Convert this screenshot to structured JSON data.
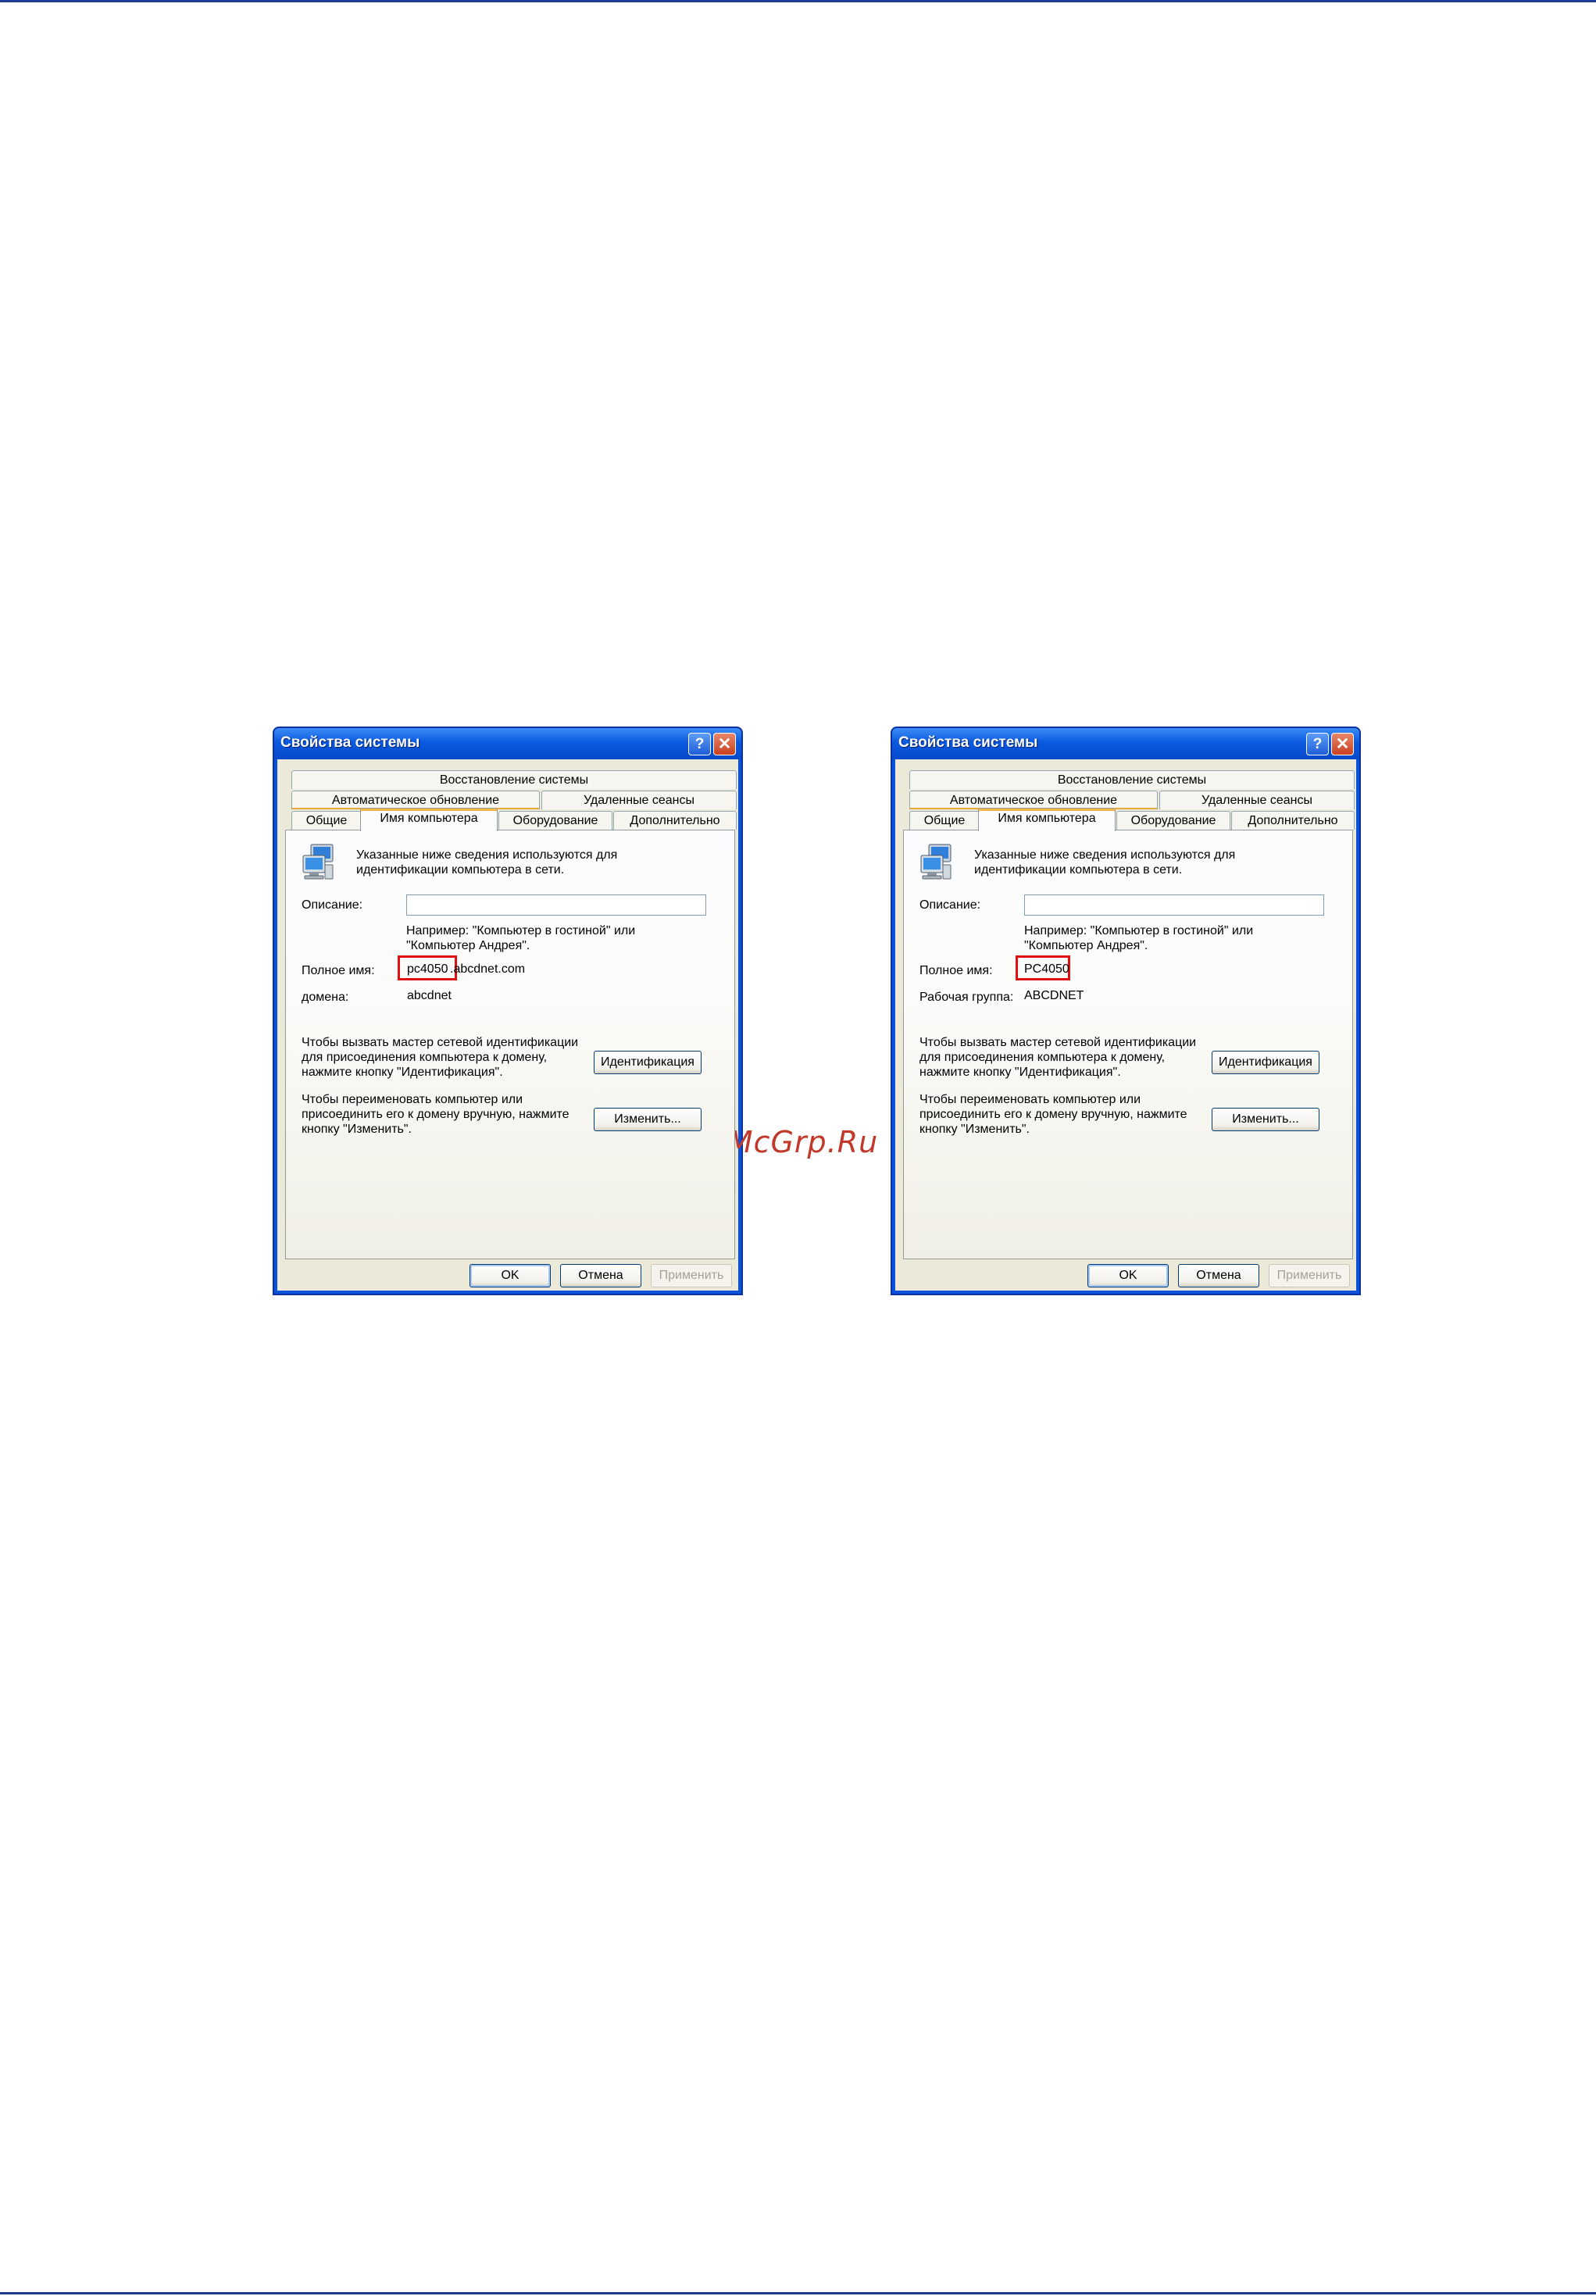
{
  "watermark": "McGrp.Ru",
  "dialogs": [
    {
      "title": "Свойства системы",
      "help_glyph": "?",
      "close_glyph": "✕",
      "tabs": {
        "restore": "Восстановление системы",
        "auto_update": "Автоматическое обновление",
        "remote": "Удаленные сеансы",
        "general": "Общие",
        "computer_name": "Имя компьютера",
        "hardware": "Оборудование",
        "advanced": "Дополнительно"
      },
      "info_line1": "Указанные ниже сведения используются для",
      "info_line2": "идентификации компьютера в сети.",
      "description_label": "Описание:",
      "description_value": "",
      "example_line1": "Например: \"Компьютер в гостиной\" или",
      "example_line2": "\"Компьютер Андрея\".",
      "fullname_label": "Полное имя:",
      "fullname_highlight": "pc4050",
      "fullname_rest": ".abcdnet.com",
      "group_label": "домена:",
      "group_value": "abcdnet",
      "wizard_line1": "Чтобы вызвать мастер сетевой идентификации",
      "wizard_line2": "для присоединения компьютера к домену,",
      "wizard_line3": "нажмите кнопку \"Идентификация\".",
      "ident_button": "Идентификация",
      "rename_line1": "Чтобы переименовать компьютер или",
      "rename_line2": "присоединить его к домену вручную, нажмите",
      "rename_line3": "кнопку \"Изменить\".",
      "change_button": "Изменить...",
      "ok_button": "OK",
      "cancel_button": "Отмена",
      "apply_button": "Применить"
    },
    {
      "title": "Свойства системы",
      "help_glyph": "?",
      "close_glyph": "✕",
      "tabs": {
        "restore": "Восстановление системы",
        "auto_update": "Автоматическое обновление",
        "remote": "Удаленные сеансы",
        "general": "Общие",
        "computer_name": "Имя компьютера",
        "hardware": "Оборудование",
        "advanced": "Дополнительно"
      },
      "info_line1": "Указанные ниже сведения используются для",
      "info_line2": "идентификации компьютера в сети.",
      "description_label": "Описание:",
      "description_value": "",
      "example_line1": "Например: \"Компьютер в гостиной\" или",
      "example_line2": "\"Компьютер Андрея\".",
      "fullname_label": "Полное имя:",
      "fullname_highlight": "PC4050",
      "fullname_rest": "",
      "group_label": "Рабочая группа:",
      "group_value": "ABCDNET",
      "wizard_line1": "Чтобы вызвать мастер сетевой идентификации",
      "wizard_line2": "для присоединения компьютера к домену,",
      "wizard_line3": "нажмите кнопку \"Идентификация\".",
      "ident_button": "Идентификация",
      "rename_line1": "Чтобы переименовать компьютер или",
      "rename_line2": "присоединить его к домену вручную, нажмите",
      "rename_line3": "кнопку \"Изменить\".",
      "change_button": "Изменить...",
      "ok_button": "OK",
      "cancel_button": "Отмена",
      "apply_button": "Применить"
    }
  ]
}
